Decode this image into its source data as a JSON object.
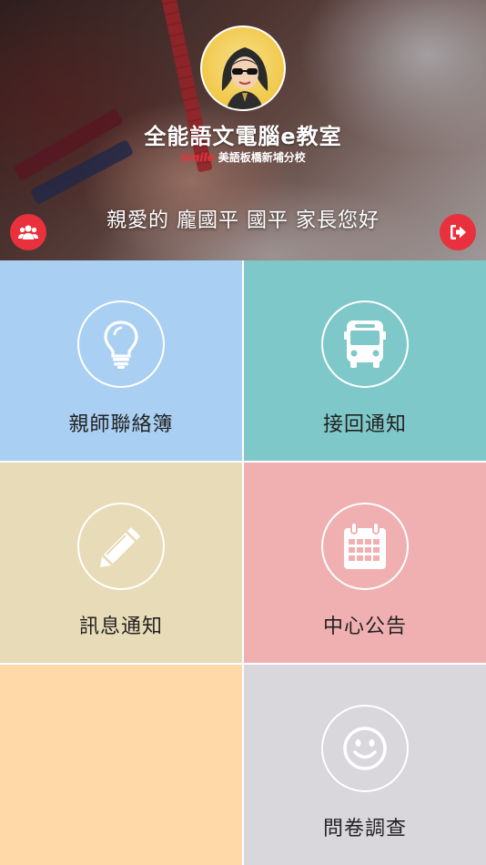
{
  "header": {
    "title": "全能語文電腦e教室",
    "subtitle_logo": "Smile",
    "subtitle": "美語板橋新埔分校",
    "greeting": "親愛的 龐國平 國平 家長您好"
  },
  "actions": {
    "family_icon": "users-icon",
    "logout_icon": "sign-out-icon"
  },
  "menu": [
    {
      "label": "親師聯絡簿",
      "icon": "lightbulb-icon",
      "color": "#a9cff2"
    },
    {
      "label": "接回通知",
      "icon": "bus-icon",
      "color": "#7fc8c9"
    },
    {
      "label": "訊息通知",
      "icon": "pencil-icon",
      "color": "#e8dbb8"
    },
    {
      "label": "中心公告",
      "icon": "calendar-icon",
      "color": "#f0b0b2"
    },
    {
      "label": "",
      "icon": "",
      "color": "#ffd9a8"
    },
    {
      "label": "問卷調查",
      "icon": "smile-icon",
      "color": "#d9d6dc"
    }
  ],
  "colors": {
    "accent": "#e8313c"
  }
}
